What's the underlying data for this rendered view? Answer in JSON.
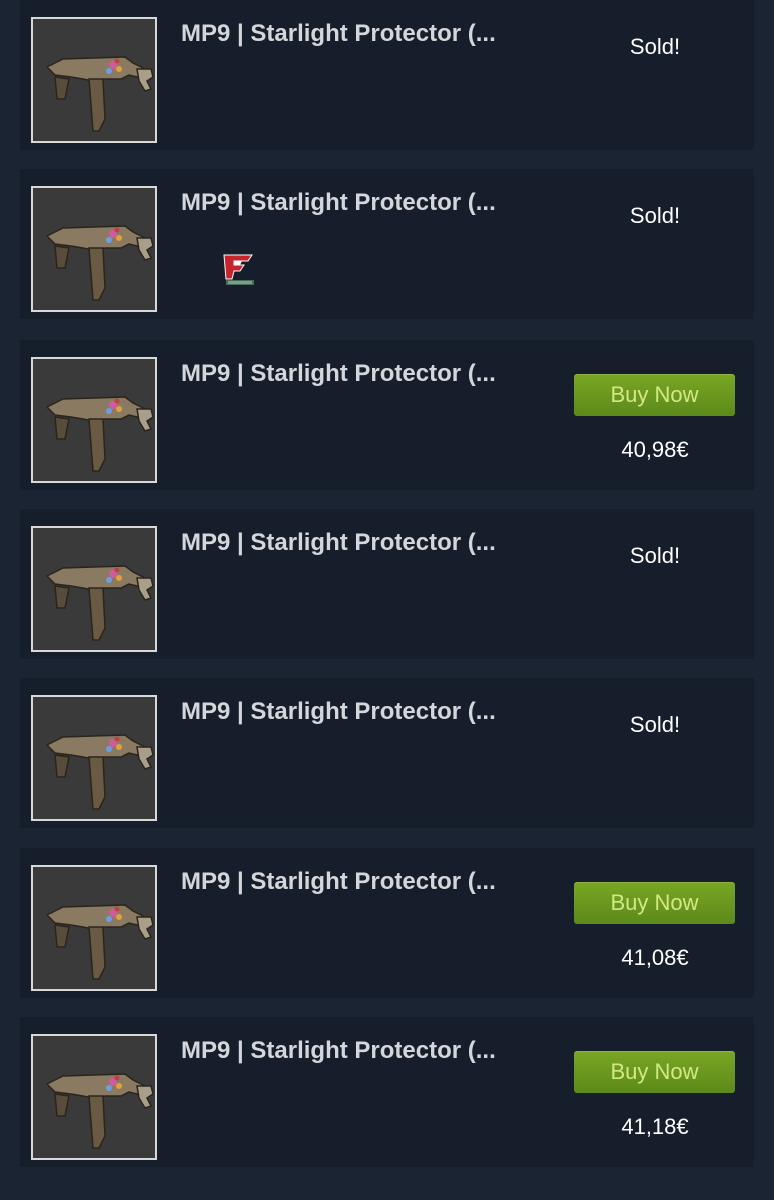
{
  "listings": [
    {
      "name": "MP9 | Starlight Protector (...",
      "status": "Sold!",
      "icon": "mp9-starlight-protector-icon",
      "sticker": null
    },
    {
      "name": "MP9 | Starlight Protector (...",
      "status": "Sold!",
      "icon": "mp9-starlight-protector-icon",
      "sticker": "faze-clan-sticker-icon"
    },
    {
      "name": "MP9 | Starlight Protector (...",
      "button_label": "Buy Now",
      "price": "40,98€",
      "icon": "mp9-starlight-protector-icon",
      "sticker": null
    },
    {
      "name": "MP9 | Starlight Protector (...",
      "status": "Sold!",
      "icon": "mp9-starlight-protector-icon",
      "sticker": null
    },
    {
      "name": "MP9 | Starlight Protector (...",
      "status": "Sold!",
      "icon": "mp9-starlight-protector-icon",
      "sticker": null
    },
    {
      "name": "MP9 | Starlight Protector (...",
      "button_label": "Buy Now",
      "price": "41,08€",
      "icon": "mp9-starlight-protector-icon",
      "sticker": null
    },
    {
      "name": "MP9 | Starlight Protector (...",
      "button_label": "Buy Now",
      "price": "41,18€",
      "icon": "mp9-starlight-protector-icon",
      "sticker": null
    }
  ],
  "colors": {
    "page_background": "#1b2432",
    "row_background": "#161e2b",
    "buy_button": "#6b9a1f",
    "buy_button_text": "#d2e885",
    "name_text": "#d3d6da"
  }
}
